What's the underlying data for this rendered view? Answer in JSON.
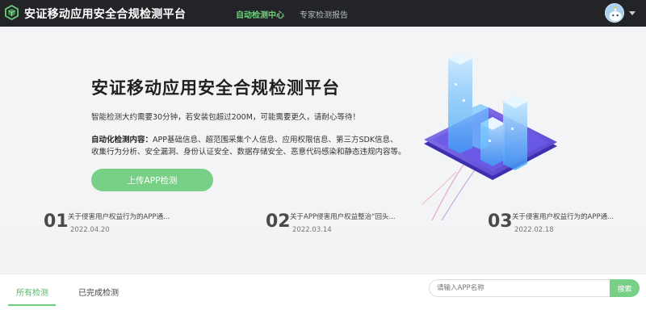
{
  "header": {
    "brand": "安证移动应用安全合规检测平台",
    "nav": [
      {
        "label": "自动检测中心",
        "active": true
      },
      {
        "label": "专家检测报告",
        "active": false
      }
    ],
    "icons": {
      "logo": "cube-logo-icon",
      "avatar": "robot-avatar-icon",
      "dropdown": "caret-down-icon"
    }
  },
  "hero": {
    "title": "安证移动应用安全合规检测平台",
    "subtitle": "智能检测大约需要30分钟，若安装包超过200M，可能需要更久，请耐心等待！",
    "content_label": "自动化检测内容：",
    "content_line1": "APP基础信息、超范围采集个人信息、应用权限信息、第三方SDK信息、",
    "content_line2": "收集行为分析、安全漏洞、身份认证安全、数据存储安全、恶意代码感染和静态违规内容等。",
    "upload_button": "上传APP检测"
  },
  "news": [
    {
      "num": "01",
      "title": "关于侵害用户权益行为的APP通...",
      "date": "2022.04.20"
    },
    {
      "num": "02",
      "title": "关于APP侵害用户权益整治“回头...",
      "date": "2022.03.14"
    },
    {
      "num": "03",
      "title": "关于侵害用户权益行为的APP通...",
      "date": "2022.02.18"
    }
  ],
  "tabs": {
    "all": "所有检测",
    "done": "已完成检测"
  },
  "search": {
    "placeholder": "请输入APP名称",
    "button": "搜索"
  },
  "colors": {
    "topbar": "#222427",
    "accent": "#78cf86",
    "active_nav": "#6fcf7c"
  }
}
